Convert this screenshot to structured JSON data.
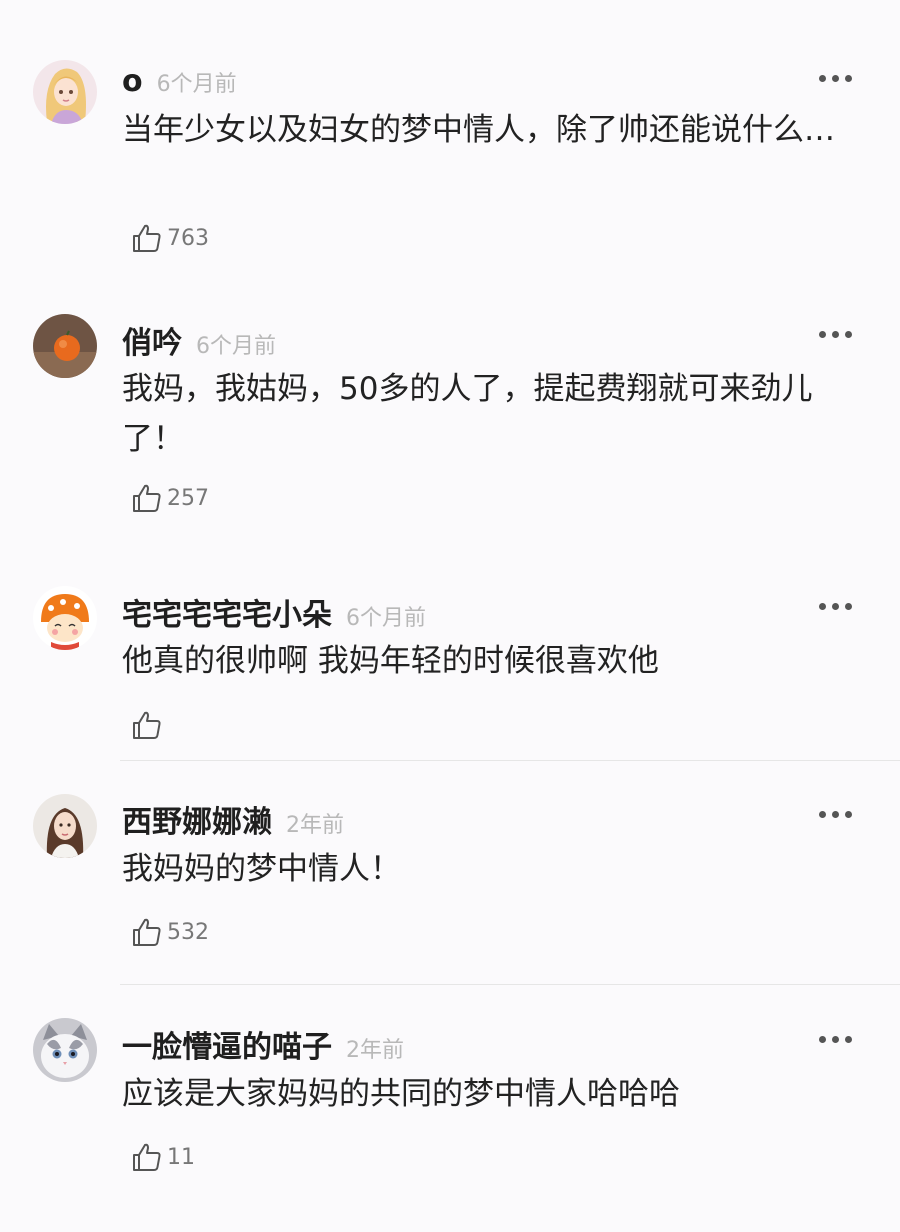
{
  "comments": [
    {
      "username": "o",
      "time": "6个月前",
      "text": "当年少女以及妇女的梦中情人，除了帅还能说什么…",
      "likes": "763",
      "avatar_icon": "blonde-girl-avatar-icon"
    },
    {
      "username": "俏吟",
      "time": "6个月前",
      "text": "我妈，我姑妈，50多的人了，提起费翔就可来劲儿了！",
      "likes": "257",
      "avatar_icon": "orange-fruit-avatar-icon"
    },
    {
      "username": "宅宅宅宅宅小朵",
      "time": "6个月前",
      "text": "他真的很帅啊 我妈年轻的时候很喜欢他",
      "likes": "",
      "avatar_icon": "cartoon-girl-orange-hat-avatar-icon"
    },
    {
      "username": "西野娜娜濑",
      "time": "2年前",
      "text": "我妈妈的梦中情人！",
      "likes": "532",
      "avatar_icon": "woman-portrait-avatar-icon"
    },
    {
      "username": "一脸懵逼的喵子",
      "time": "2年前",
      "text": "应该是大家妈妈的共同的梦中情人哈哈哈",
      "likes": "11",
      "avatar_icon": "white-cat-avatar-icon"
    }
  ],
  "icons": {
    "more": "more-dots-icon",
    "like": "thumbs-up-icon"
  },
  "colors": {
    "username": "#1f1f1f",
    "time": "#b8b8b8",
    "text": "#222222",
    "like_count": "#777777"
  }
}
